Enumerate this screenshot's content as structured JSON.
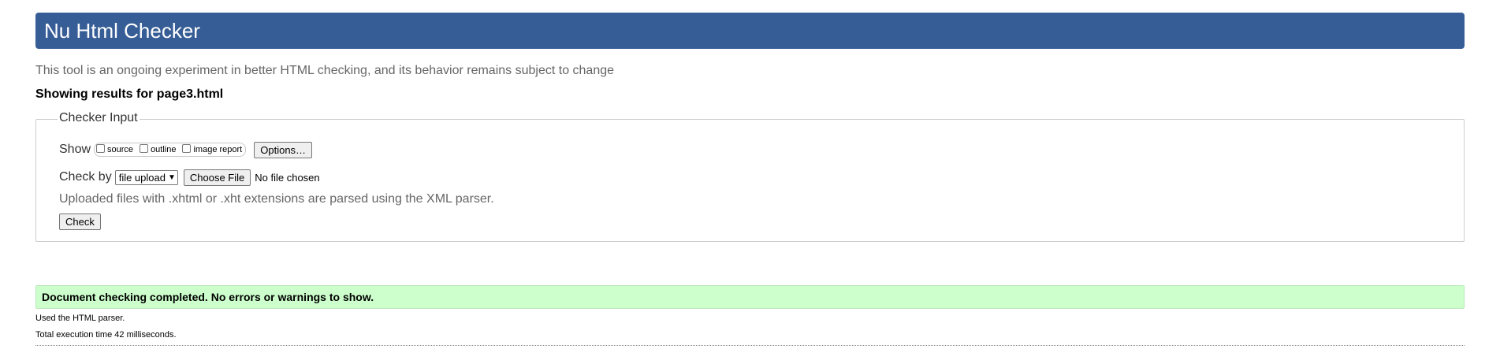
{
  "header": {
    "title": "Nu Html Checker",
    "color": "#365d95"
  },
  "subtitle": "This tool is an ongoing experiment in better HTML checking, and its behavior remains subject to change",
  "results_for": "Showing results for page3.html",
  "checker_input": {
    "legend": "Checker Input",
    "show_label": "Show",
    "show_options": [
      {
        "label": "source",
        "checked": false
      },
      {
        "label": "outline",
        "checked": false
      },
      {
        "label": "image report",
        "checked": false
      }
    ],
    "options_button": "Options…",
    "check_by_label": "Check by",
    "check_by_select": {
      "value": "file upload",
      "icon": "chevron-down-icon"
    },
    "choose_file_button": "Choose File",
    "file_status": "No file chosen",
    "note": "Uploaded files with .xhtml or .xht extensions are parsed using the XML parser.",
    "check_button": "Check"
  },
  "result": {
    "message": "Document checking completed. No errors or warnings to show.",
    "color": "#ccffcc"
  },
  "info": {
    "parser": "Used the HTML parser.",
    "execution_time": "Total execution time 42 milliseconds."
  }
}
